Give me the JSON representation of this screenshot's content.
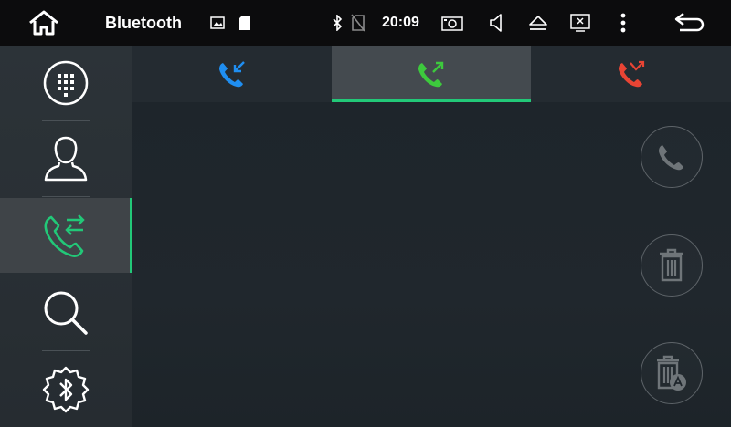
{
  "statusbar": {
    "title": "Bluetooth",
    "time": "20:09",
    "icons": [
      "home-icon",
      "image-icon",
      "sd-card-icon",
      "bluetooth-icon",
      "no-sim-icon",
      "screenshot-icon",
      "volume-icon",
      "eject-icon",
      "close-window-icon",
      "more-icon",
      "back-icon"
    ]
  },
  "sidebar": {
    "items": [
      {
        "name": "dialpad",
        "icon": "dialpad-icon"
      },
      {
        "name": "contacts",
        "icon": "contact-icon"
      },
      {
        "name": "call-log",
        "icon": "call-log-icon",
        "active": true
      },
      {
        "name": "search",
        "icon": "search-icon"
      },
      {
        "name": "bluetooth-settings",
        "icon": "bluetooth-settings-icon"
      }
    ]
  },
  "tabs": [
    {
      "name": "incoming-calls",
      "icon": "incoming-call-icon",
      "color": "#1f8ef1"
    },
    {
      "name": "outgoing-calls",
      "icon": "outgoing-call-icon",
      "color": "#3dc93d",
      "active": true
    },
    {
      "name": "missed-calls",
      "icon": "missed-call-icon",
      "color": "#e84434"
    }
  ],
  "actions": [
    "call-button",
    "delete-button",
    "delete-all-button"
  ],
  "colors": {
    "accent": "#22c878",
    "statusbar": "#0c0c0d"
  }
}
